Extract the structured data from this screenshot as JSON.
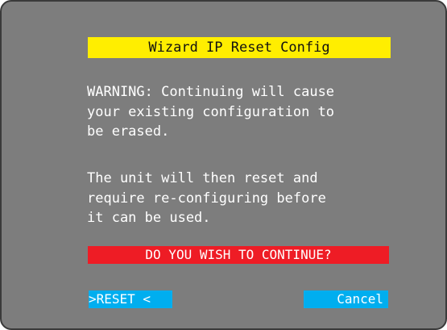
{
  "dialog": {
    "title": "Wizard IP Reset Config",
    "warning_lines": [
      "WARNING: Continuing will cause",
      "your existing configuration to",
      "be erased."
    ],
    "info_lines": [
      "The unit will then reset and",
      "require re-configuring before",
      "it can be used."
    ],
    "question": "DO YOU WISH TO CONTINUE?"
  },
  "buttons": {
    "reset_label": ">RESET <",
    "cancel_label": "Cancel"
  },
  "colors": {
    "background": "#7d7d7d",
    "title_bar": "#ffee00",
    "question_bar": "#ee1c25",
    "button": "#00aeef",
    "text": "#ffffff"
  }
}
